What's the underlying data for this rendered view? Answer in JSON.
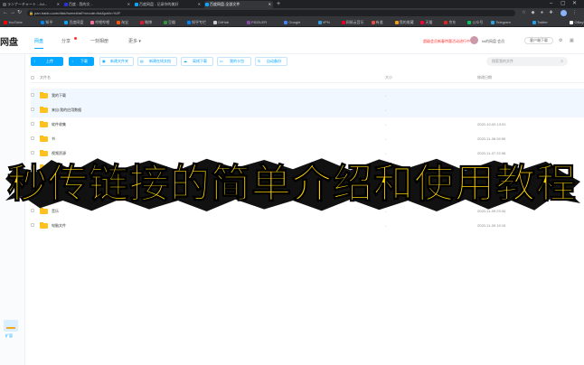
{
  "browser": {
    "tabs": [
      {
        "label": "ランナーチャート - Jul...",
        "color": "#5f6368"
      },
      {
        "label": "百度 - 我的文...",
        "color": "#2932e1"
      },
      {
        "label": "百度网盘 - 记录你的美好",
        "color": "#06a7ff"
      },
      {
        "label": "百度网盘-全部文件",
        "color": "#06a7ff"
      }
    ],
    "new_tab": "+",
    "url": "pan.baidu.com/disk/home#/all?vmode=list&path=%2F",
    "bookmarks": [
      {
        "label": "YouTube",
        "color": "#ff0000"
      },
      {
        "label": "知乎",
        "color": "#0084ff"
      },
      {
        "label": "百度网盘",
        "color": "#06a7ff"
      },
      {
        "label": "哔哩哔哩",
        "color": "#fb7299"
      },
      {
        "label": "淘宝",
        "color": "#ff5000"
      },
      {
        "label": "微博",
        "color": "#e6162d"
      },
      {
        "label": "豆瓣",
        "color": "#2e963d"
      },
      {
        "label": "知乎专栏",
        "color": "#0084ff"
      },
      {
        "label": "GitHub",
        "color": "#cccccc"
      },
      {
        "label": "FIDDLER",
        "color": "#8e44ad"
      },
      {
        "label": "Google",
        "color": "#4285f4"
      },
      {
        "label": "VPN",
        "color": "#3498db"
      },
      {
        "label": "网易云音乐",
        "color": "#e60026"
      },
      {
        "label": "有道",
        "color": "#e74c3c"
      },
      {
        "label": "我的收藏",
        "color": "#f39c12"
      },
      {
        "label": "天猫",
        "color": "#ff0036"
      },
      {
        "label": "京东",
        "color": "#e1251b"
      },
      {
        "label": "公众号",
        "color": "#07c160"
      },
      {
        "label": "Telegram",
        "color": "#2ca5e0"
      },
      {
        "label": "Twitter",
        "color": "#1da1f2"
      },
      {
        "label": "OBayScore",
        "color": "#ffffff"
      }
    ]
  },
  "app": {
    "logo": "网盘",
    "nav": [
      {
        "label": "网盘"
      },
      {
        "label": "分享"
      },
      {
        "label": "一刻相册"
      },
      {
        "label": "更多"
      }
    ],
    "promo": "超级会员新春特惠活动进行中",
    "user": "kk的网盘 会员",
    "client_button": "客户端下载"
  },
  "toolbar": {
    "buttons": [
      {
        "label": "上传"
      },
      {
        "label": "下载"
      },
      {
        "label": "新建文件夹"
      },
      {
        "label": "新建在线文档"
      },
      {
        "label": "离线下载"
      },
      {
        "label": "我的卡包"
      },
      {
        "label": "自动备份"
      }
    ],
    "search_placeholder": "搜索我的文件"
  },
  "columns": {
    "name": "文件名",
    "size": "大小",
    "date": "修改日期"
  },
  "files": [
    {
      "name": "我的下载",
      "size": "-",
      "date": ""
    },
    {
      "name": "来自:我的应用数据",
      "size": "-",
      "date": ""
    },
    {
      "name": "软件收集",
      "size": "-",
      "date": "2020-10-05 13:51"
    },
    {
      "name": "书",
      "size": "-",
      "date": "2020-11-08 09:59"
    },
    {
      "name": "视频资源",
      "size": "-",
      "date": "2020-11-07 22:08"
    },
    {
      "name": "图片",
      "size": "-",
      "date": "2020-11-10 07:15"
    },
    {
      "name": "文档",
      "size": "-",
      "date": "2020-11-09 21:40"
    },
    {
      "name": "资源文件",
      "size": "-",
      "date": "2020-11-11 09:11"
    },
    {
      "name": "音乐",
      "size": "-",
      "date": "2020-11-09 23:34"
    },
    {
      "name": "电脑文件",
      "size": "-",
      "date": "2020-11-09 19:15"
    }
  ],
  "sidebar": {
    "expand_label": "扩容"
  },
  "banner": {
    "text": "秒传链接的简单介绍和使用教程"
  }
}
